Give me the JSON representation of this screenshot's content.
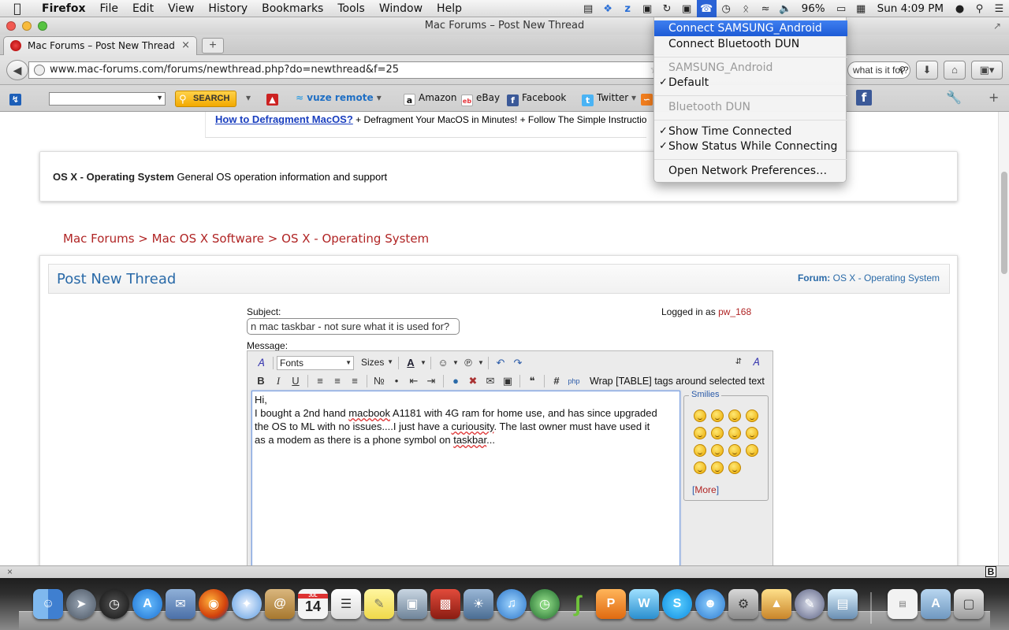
{
  "menubar": {
    "app": "Firefox",
    "items": [
      "File",
      "Edit",
      "View",
      "History",
      "Bookmarks",
      "Tools",
      "Window",
      "Help"
    ],
    "battery": "96%",
    "clock": "Sun 4:09 PM"
  },
  "window": {
    "title": "Mac Forums – Post New Thread",
    "tab_label": "Mac Forums – Post New Thread"
  },
  "navbar": {
    "url": "www.mac-forums.com/forums/newthread.php?do=newthread&f=25",
    "search_value": "what is it for?"
  },
  "bookmarks": {
    "search_button": "SEARCH",
    "vuze": "vuze remote",
    "items": [
      "Amazon",
      "eBay",
      "Facebook",
      "Twitter"
    ]
  },
  "page": {
    "ad_link": "How to Defragment MacOS?",
    "ad_text": "+ Defragment Your MacOS in Minutes! + Follow The Simple Instructio",
    "forum_name": "OS X - Operating System",
    "forum_desc": "General OS operation information and support",
    "breadcrumb": "Mac Forums > Mac OS X Software > OS X - Operating System",
    "thread_title": "Post New Thread",
    "forum_label": "Forum:",
    "forum_value": "OS X - Operating System",
    "subject_label": "Subject:",
    "subject_value": "n mac taskbar - not sure what it is used for?",
    "logged_in_label": "Logged in as",
    "logged_in_user": "pw_168",
    "message_label": "Message:"
  },
  "editor": {
    "fonts": "Fonts",
    "sizes": "Sizes",
    "table_label": "Wrap [TABLE] tags around selected text",
    "body": {
      "l1": "Hi,",
      "l2a": "I bought a 2nd hand ",
      "w_macbook": "macbook",
      "l2b": " A1181 with 4G ram for home use, and has since upgraded",
      "l3a": "the OS to ML with no issues....I just have a ",
      "w_curiosity": "curiousity",
      "l3b": ".  The last owner must have used it",
      "l4": "as a modem as there is a phone symbol on ",
      "w_taskbar": "taskbar",
      "l4b": "..."
    },
    "smilies_label": "Smilies",
    "more_label": "More"
  },
  "netmenu": {
    "connect_samsung": "Connect SAMSUNG_Android",
    "connect_bt": "Connect Bluetooth DUN",
    "samsung_header": "SAMSUNG_Android",
    "default": "Default",
    "bt_header": "Bluetooth DUN",
    "show_time": "Show Time Connected",
    "show_status": "Show Status While Connecting",
    "open_prefs": "Open Network Preferences…"
  },
  "statusbar": {
    "close": "×",
    "b": "B"
  },
  "dock": {
    "calendar_day": "14"
  },
  "colors": {
    "accent": "#2a63d6",
    "forum_red": "#b02424",
    "link_blue": "#2a6aa8"
  }
}
